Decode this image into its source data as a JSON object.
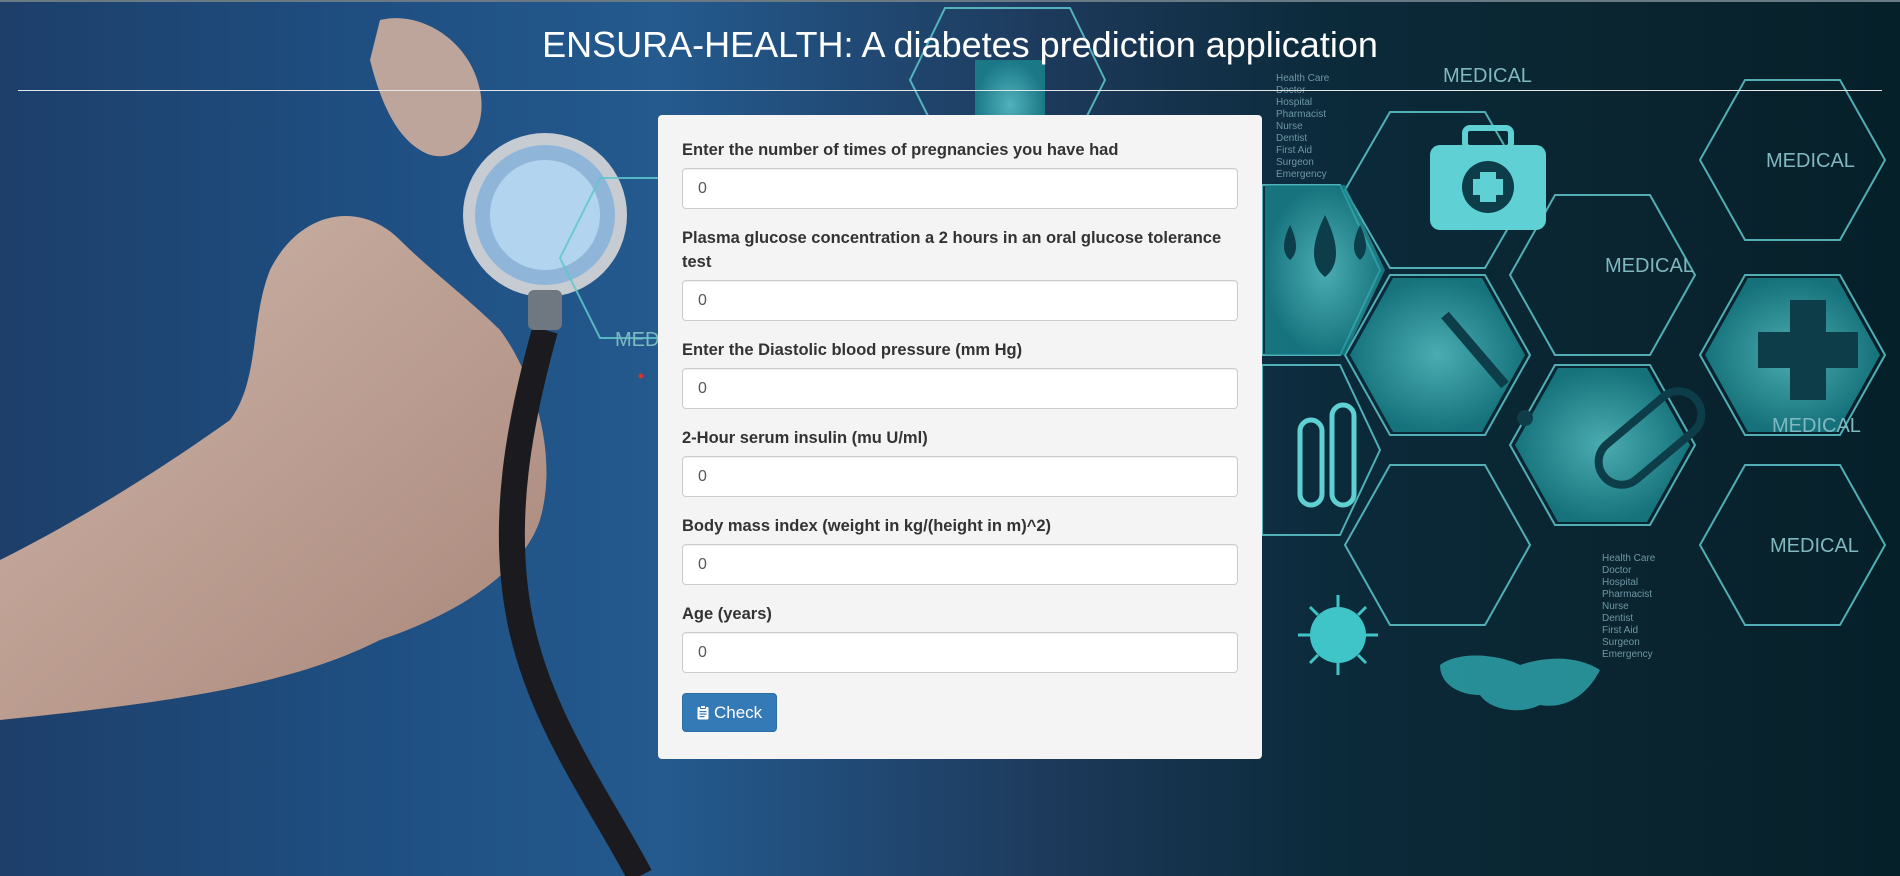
{
  "header": {
    "title": "ENSURA-HEALTH: A diabetes prediction application"
  },
  "background": {
    "hex_label": "MEDICAL",
    "hex_label_partial": "MED",
    "list_items": [
      "Health Care",
      "Doctor",
      "Hospital",
      "Pharmacist",
      "Nurse",
      "Dentist",
      "First Aid",
      "Surgeon",
      "Emergency"
    ]
  },
  "form": {
    "fields": [
      {
        "label": "Enter the number of times of pregnancies you have had",
        "placeholder": "0"
      },
      {
        "label": "Plasma glucose concentration a 2 hours in an oral glucose tolerance test",
        "placeholder": "0"
      },
      {
        "label": "Enter the Diastolic blood pressure (mm Hg)",
        "placeholder": "0"
      },
      {
        "label": "2-Hour serum insulin (mu U/ml)",
        "placeholder": "0"
      },
      {
        "label": "Body mass index (weight in kg/(height in m)^2)",
        "placeholder": "0"
      },
      {
        "label": "Age (years)",
        "placeholder": "0"
      }
    ],
    "submit_label": "Check",
    "submit_icon": "clipboard-icon"
  },
  "colors": {
    "panel_bg": "#f4f4f4",
    "button_bg": "#337ab7",
    "accent_teal": "#2ec4c6"
  }
}
